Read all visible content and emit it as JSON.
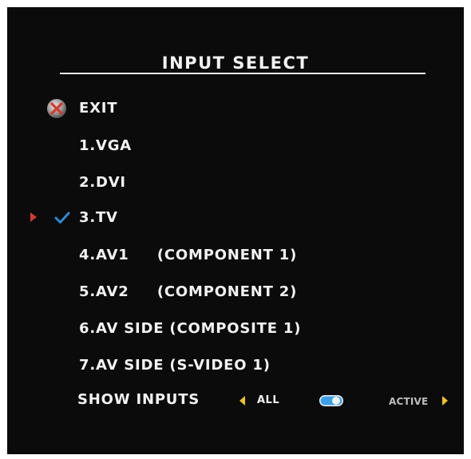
{
  "menu": {
    "title": "INPUT SELECT",
    "items": [
      {
        "label": "EXIT",
        "icon": "exit-x-icon"
      },
      {
        "label": "1.VGA"
      },
      {
        "label": "2.DVI"
      },
      {
        "label": "3.TV",
        "selected": true
      },
      {
        "label": "4.AV1     (COMPONENT 1)"
      },
      {
        "label": "5.AV2     (COMPONENT 2)"
      },
      {
        "label": "6.AV SIDE (COMPOSITE 1)"
      },
      {
        "label": "7.AV SIDE (S-VIDEO 1)"
      }
    ]
  },
  "show_inputs": {
    "label": "SHOW INPUTS",
    "left_option": "ALL",
    "right_option": "ACTIVE",
    "current": "ALL"
  },
  "colors": {
    "background": "#0b0b0b",
    "text": "#f2f2f2",
    "arrow": "#f2c318",
    "check": "#2a8ad8",
    "cursor": "#d63a2a",
    "toggle": "#3aa0e8"
  }
}
